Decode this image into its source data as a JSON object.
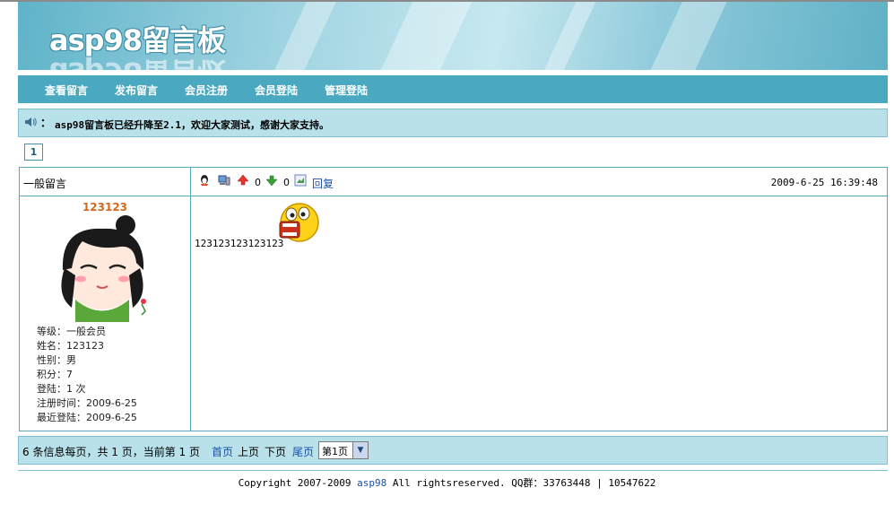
{
  "header": {
    "logo": "asp98留言板"
  },
  "nav": {
    "items": [
      {
        "label": "查看留言"
      },
      {
        "label": "发布留言"
      },
      {
        "label": "会员注册"
      },
      {
        "label": "会员登陆"
      },
      {
        "label": "管理登陆"
      }
    ]
  },
  "notice": {
    "colon": "：",
    "text": "asp98留言板已经升降至2.1，欢迎大家测试，感谢大家支持。"
  },
  "pagination_top": {
    "current_page": "1"
  },
  "message": {
    "category": "一般留言",
    "up_count": "0",
    "down_count": "0",
    "reply_label": "回复",
    "datetime": "2009-6-25 16:39:48",
    "username": "123123",
    "content": "123123123123123",
    "user_info": [
      "等级：一般会员",
      "姓名：123123",
      "性别：男",
      "积分：7",
      "登陆：1 次",
      "注册时间：2009-6-25",
      "最近登陆：2009-6-25"
    ]
  },
  "pager": {
    "summary": "6 条信息每页，共 1 页，当前第 1 页",
    "first": "首页",
    "prev": "上页",
    "next": "下页",
    "last": "尾页",
    "select_value": "第1页"
  },
  "footer": {
    "copyright": "Copyright 2007-2009",
    "brand": "asp98",
    "rights": "All rightsreserved. QQ群：33763448 | 10547622"
  }
}
